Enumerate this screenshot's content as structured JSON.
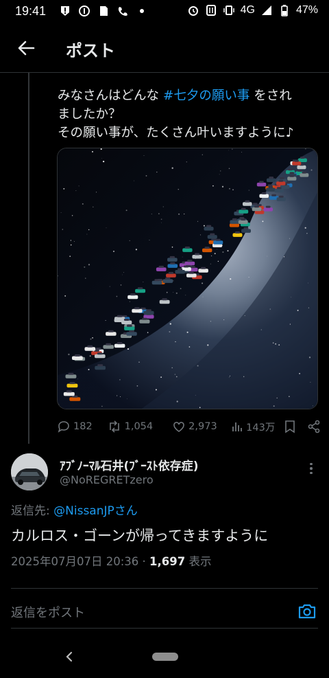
{
  "status": {
    "time": "19:41",
    "network": "4G",
    "battery": "47%"
  },
  "header": {
    "title": "ポスト"
  },
  "tweet": {
    "text_line1_prefix": "みなさんはどんな ",
    "hashtag": "#七夕の願い事",
    "text_line1_suffix": " をされ",
    "text_line2": "ましたか？",
    "text_line3": "その願い事が、たくさん叶いますように♪",
    "actions": {
      "replies": "182",
      "reposts": "1,054",
      "likes": "2,973",
      "views": "143万"
    }
  },
  "reply": {
    "display_name": "ｱﾌﾞﾉｰﾏﾙ石井(ﾌﾞｰｽﾄ依存症)",
    "handle": "@NoREGRETzero",
    "reply_to_label": "返信先: ",
    "reply_to_mention": "@NissanJPさん",
    "body": "カルロス・ゴーンが帰ってきますように",
    "date": "2025年07月07日 20:36 · ",
    "view_count": "1,697",
    "view_label": " 表示"
  },
  "compose": {
    "placeholder": "返信をポスト"
  },
  "colors": {
    "accent": "#1d9bf0",
    "text": "#e7e9ea",
    "muted": "#71767b",
    "border": "#2f3336"
  }
}
